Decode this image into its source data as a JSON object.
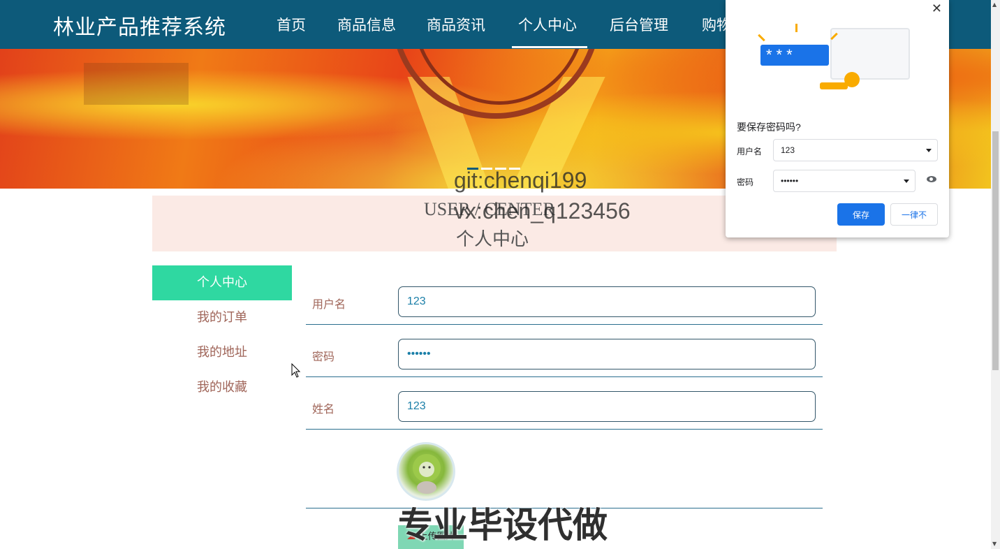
{
  "header": {
    "brand": "林业产品推荐系统",
    "nav": [
      {
        "label": "首页"
      },
      {
        "label": "商品信息"
      },
      {
        "label": "商品资讯"
      },
      {
        "label": "个人中心",
        "active": true
      },
      {
        "label": "后台管理"
      },
      {
        "label": "购物"
      }
    ]
  },
  "banner": {
    "slides": 4,
    "active_slide": 1
  },
  "title": {
    "en": "USER / CENTER",
    "cn": "个人中心"
  },
  "watermarks": {
    "git": "git:chenqi199",
    "vx": "vx:chen_q123456",
    "big": "专业毕设代做"
  },
  "sidebar": {
    "items": [
      {
        "label": "个人中心",
        "active": true
      },
      {
        "label": "我的订单"
      },
      {
        "label": "我的地址"
      },
      {
        "label": "我的收藏"
      }
    ]
  },
  "form": {
    "username_label": "用户名",
    "username_value": "123",
    "password_label": "密码",
    "password_value": "••••••",
    "name_label": "姓名",
    "name_value": "123",
    "upload_label": "上传图片"
  },
  "password_popup": {
    "title": "要保存密码吗?",
    "illustration_text": "***",
    "username_label": "用户名",
    "username_value": "123",
    "password_label": "密码",
    "password_value": "••••••",
    "save_label": "保存",
    "never_label": "一律不",
    "close_icon": "✕"
  },
  "colors": {
    "nav_bg": "#0d5a7a",
    "side_active": "#2fd8a1",
    "popup_primary": "#1a73e8"
  }
}
